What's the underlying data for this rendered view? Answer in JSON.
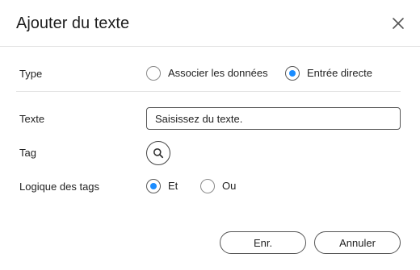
{
  "dialog": {
    "title": "Ajouter du texte",
    "close_icon": "close-icon"
  },
  "type_row": {
    "label": "Type",
    "options": [
      {
        "label": "Associer les données",
        "selected": false
      },
      {
        "label": "Entrée directe",
        "selected": true
      }
    ]
  },
  "text_row": {
    "label": "Texte",
    "value": "Saisissez du texte.",
    "placeholder": "Saisissez du texte."
  },
  "tag_row": {
    "label": "Tag",
    "search_icon": "search-icon"
  },
  "logic_row": {
    "label": "Logique des tags",
    "options": [
      {
        "label": "Et",
        "selected": true
      },
      {
        "label": "Ou",
        "selected": false
      }
    ]
  },
  "footer": {
    "save_label": "Enr.",
    "cancel_label": "Annuler"
  },
  "colors": {
    "accent": "#1a8cff",
    "border": "#555555",
    "divider": "#e1e1e1"
  }
}
